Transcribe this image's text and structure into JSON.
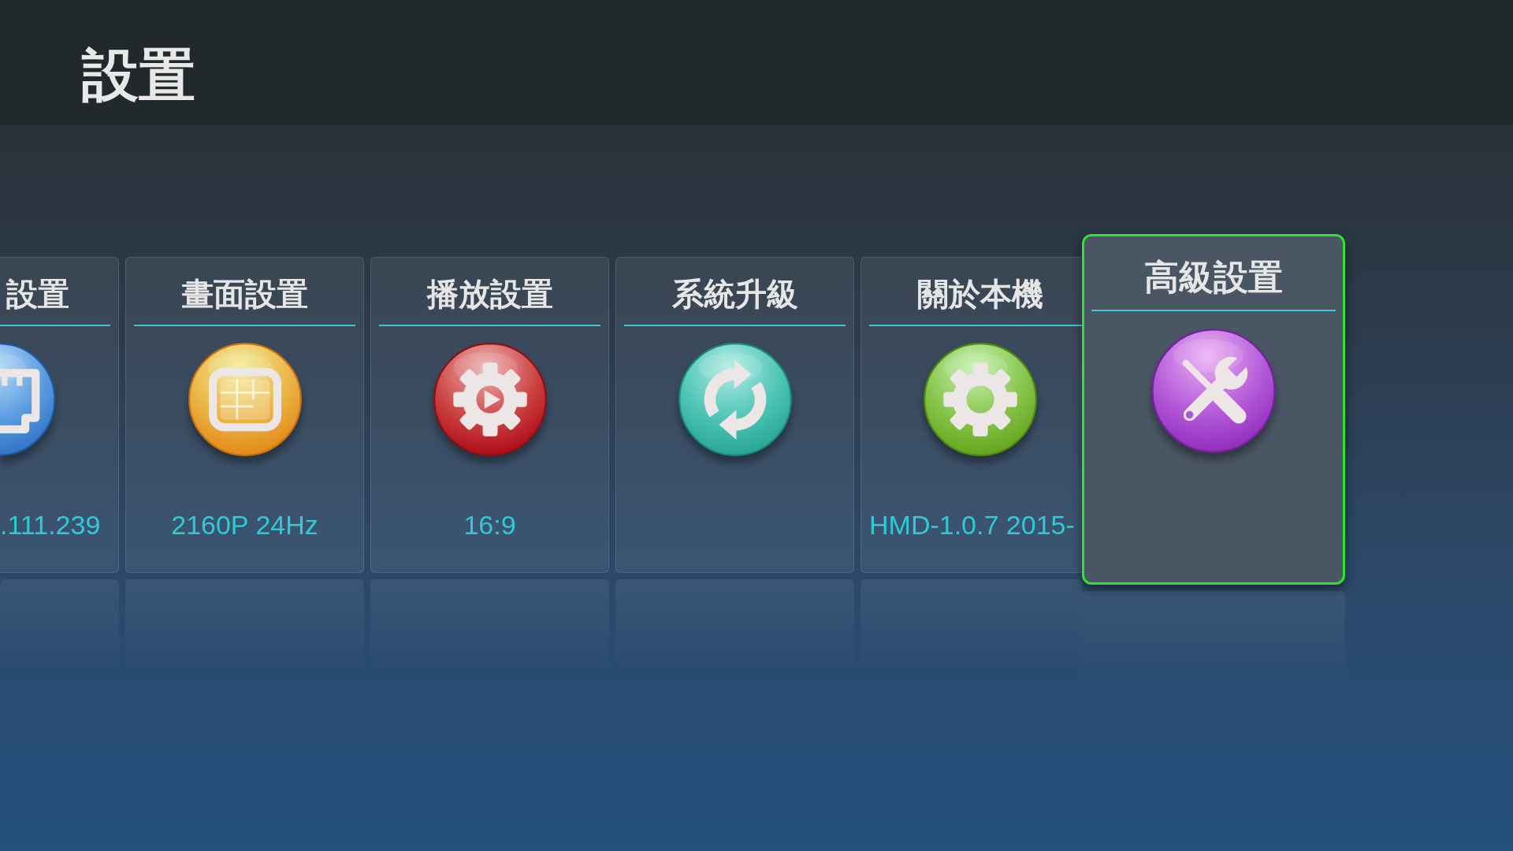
{
  "header": {
    "title": "設置"
  },
  "cards": [
    {
      "title": "設置",
      "kind": "network",
      "value": ".111.239",
      "selected": false
    },
    {
      "title": "畫面設置",
      "kind": "display",
      "value": "2160P 24Hz",
      "selected": false
    },
    {
      "title": "播放設置",
      "kind": "playback",
      "value": "16:9",
      "selected": false
    },
    {
      "title": "系統升級",
      "kind": "upgrade",
      "selected": false
    },
    {
      "title": "關於本機",
      "kind": "about",
      "value": "HMD-1.0.7 2015-",
      "selected": false
    },
    {
      "title": "高級設置",
      "kind": "advanced",
      "selected": true
    }
  ]
}
